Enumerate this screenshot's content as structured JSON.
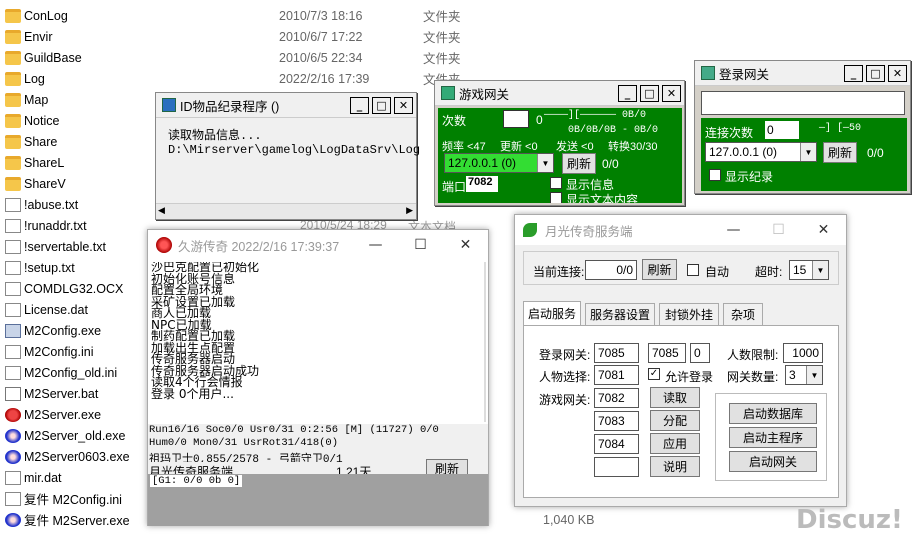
{
  "explorer": {
    "files": [
      {
        "name": "ConLog",
        "date": "2010/7/3 18:16",
        "type": "文件夹",
        "icon": "folder-icon"
      },
      {
        "name": "Envir",
        "date": "2010/6/7 17:22",
        "type": "文件夹",
        "icon": "folder-icon"
      },
      {
        "name": "GuildBase",
        "date": "2010/6/5 22:34",
        "type": "文件夹",
        "icon": "folder-icon"
      },
      {
        "name": "Log",
        "date": "2022/2/16 17:39",
        "type": "文件夹",
        "icon": "folder-icon"
      },
      {
        "name": "Map",
        "date": "",
        "type": "",
        "icon": "folder-icon"
      },
      {
        "name": "Notice",
        "date": "",
        "type": "",
        "icon": "folder-icon"
      },
      {
        "name": "Share",
        "date": "",
        "type": "",
        "icon": "folder-icon"
      },
      {
        "name": "ShareL",
        "date": "",
        "type": "",
        "icon": "folder-icon"
      },
      {
        "name": "ShareV",
        "date": "",
        "type": "",
        "icon": "folder-icon"
      },
      {
        "name": "!abuse.txt",
        "date": "",
        "type": "",
        "icon": "document-icon"
      },
      {
        "name": "!runaddr.txt",
        "date": "",
        "type": "",
        "icon": "document-icon"
      },
      {
        "name": "!servertable.txt",
        "date": "",
        "type": "",
        "icon": "document-icon"
      },
      {
        "name": "!setup.txt",
        "date": "",
        "type": "",
        "icon": "document-icon"
      },
      {
        "name": "COMDLG32.OCX",
        "date": "",
        "type": "",
        "icon": "document-icon"
      },
      {
        "name": "License.dat",
        "date": "",
        "type": "",
        "icon": "document-icon"
      },
      {
        "name": "M2Config.exe",
        "date": "",
        "type": "",
        "icon": "application-icon"
      },
      {
        "name": "M2Config.ini",
        "date": "",
        "type": "",
        "icon": "settings-file-icon"
      },
      {
        "name": "M2Config_old.ini",
        "date": "",
        "type": "",
        "icon": "settings-file-icon"
      },
      {
        "name": "M2Server.bat",
        "date": "",
        "type": "",
        "icon": "batch-file-icon"
      },
      {
        "name": "M2Server.exe",
        "date": "",
        "type": "",
        "icon": "dragon-app-icon"
      },
      {
        "name": "M2Server_old.exe",
        "date": "",
        "type": "",
        "icon": "blue-app-icon"
      },
      {
        "name": "M2Server0603.exe",
        "date": "",
        "type": "",
        "icon": "blue-app-icon"
      },
      {
        "name": "mir.dat",
        "date": "",
        "type": "",
        "icon": "document-icon"
      },
      {
        "name": "复件 M2Config.ini",
        "date": "",
        "type": "",
        "icon": "settings-file-icon"
      },
      {
        "name": "复件 M2Server.exe",
        "date": "",
        "type": "",
        "icon": "blue-app-icon"
      }
    ],
    "partial_date": "2010/5/24 18:29",
    "partial_type": "文本文档",
    "size_text": "1,040 KB"
  },
  "id_window": {
    "title": "ID物品纪录程序 ()",
    "line1": "读取物品信息...",
    "line2": "D:\\Mirserver\\gamelog\\LogDataSrv\\Log"
  },
  "gamegate": {
    "title": "游戏网关",
    "row1_label": "次数",
    "row1_val": "0",
    "row1_right": "————][——————  0B/0",
    "row2": "0B/0B/0B - 0B/0",
    "row3_a": "频率 <47",
    "row3_b": "更新 <0",
    "row3_c": "发送 <0",
    "row3_d": "转换30/30",
    "ip": "127.0.0.1 (0)",
    "refresh": "刷新",
    "count": "0/0",
    "port_label": "端口",
    "port": "7082",
    "chk1": "显示信息",
    "chk2": "显示文本内容"
  },
  "logingate": {
    "title": "登录网关",
    "conn_label": "连接次数",
    "conn_val": "0",
    "conn_right": "—]  [—50",
    "ip": "127.0.0.1 (0)",
    "refresh": "刷新",
    "count": "0/0",
    "chk": "显示纪录"
  },
  "jiuyou": {
    "title": "久游传奇 2022/2/16 17:39:37",
    "log": [
      "沙巴克配置已初始化",
      "初始化账号信息",
      "配置全局环境",
      "采矿设置已加载",
      "商人已加载",
      "NPC已加载",
      "制药配置已加载",
      "加载出生点配置",
      "传奇服务器启动",
      "传奇服务器启动成功",
      "读取4个行会情报",
      "登录 0个用户..."
    ],
    "stat1": "Run16/16 Soc0/0 Usr0/31  0:2:56 [M]     (11727)   0/0",
    "stat2": "Hum0/0 Mon0/31 UsrRot31/418(0)",
    "stat3": "祖玛卫士0,855/2578 - 弓箭守卫0/1",
    "footer_name": "月光传奇服务端",
    "footer_days": "1.21天",
    "refresh": "刷新",
    "footer_grid": "[G1: 0/0 0b 0]"
  },
  "moonlight": {
    "title": "月光传奇服务端",
    "conn_label": "当前连接:",
    "conn_val": "0/0",
    "refresh": "刷新",
    "auto": "自动",
    "timeout_label": "超时:",
    "timeout_val": "15",
    "tabs": [
      "启动服务",
      "服务器设置",
      "封锁外挂",
      "杂项"
    ],
    "login_gate_label": "登录网关:",
    "login_port1": "7085",
    "login_port2": "7085",
    "login_port3": "0",
    "limit_label": "人数限制:",
    "limit_val": "1000",
    "char_label": "人物选择:",
    "char_port": "7081",
    "allow_login": "允许登录",
    "gate_count_label": "网关数量:",
    "gate_count_val": "3",
    "game_gate_label": "游戏网关:",
    "game_ports": [
      "7082",
      "7083",
      "7084",
      ""
    ],
    "btn_read": "读取",
    "btn_alloc": "分配",
    "btn_apply": "应用",
    "btn_explain": "说明",
    "btn_db": "启动数据库",
    "btn_main": "启动主程序",
    "btn_gate": "启动网关"
  },
  "watermark": "Discuz!"
}
